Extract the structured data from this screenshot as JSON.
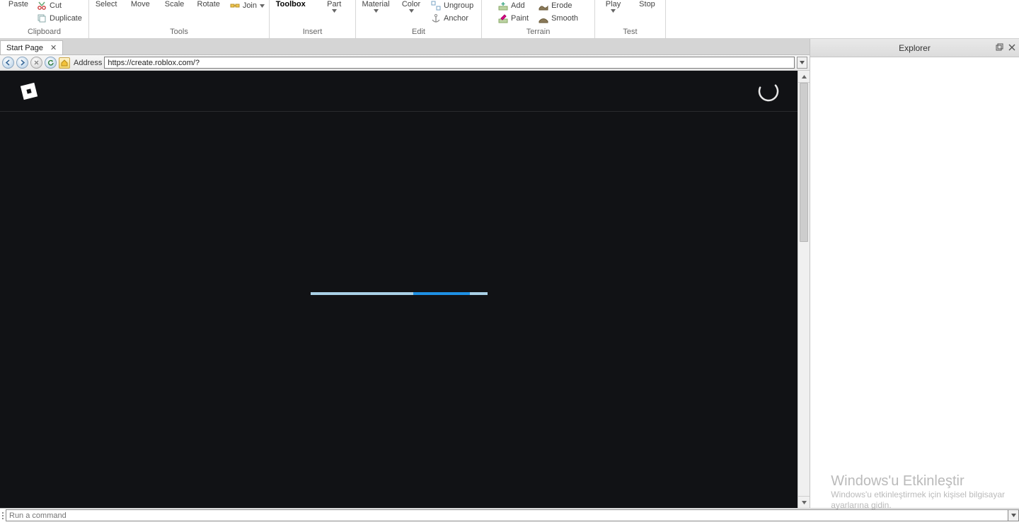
{
  "ribbon": {
    "clipboard": {
      "paste": "Paste",
      "cut": "Cut",
      "duplicate": "Duplicate",
      "group": "Clipboard"
    },
    "tools": {
      "select": "Select",
      "move": "Move",
      "scale": "Scale",
      "rotate": "Rotate",
      "join": "Join",
      "group": "Tools"
    },
    "insert": {
      "toolbox": "Toolbox",
      "part": "Part",
      "group": "Insert"
    },
    "edit": {
      "material": "Material",
      "color": "Color",
      "ungroup": "Ungroup",
      "anchor": "Anchor",
      "group": "Edit"
    },
    "terrain": {
      "add": "Add",
      "paint": "Paint",
      "erode": "Erode",
      "smooth": "Smooth",
      "group": "Terrain"
    },
    "test": {
      "play": "Play",
      "stop": "Stop",
      "group": "Test"
    }
  },
  "tab": {
    "label": "Start Page"
  },
  "nav": {
    "address_label": "Address",
    "url": "https://create.roblox.com/?"
  },
  "explorer": {
    "title": "Explorer"
  },
  "command": {
    "placeholder": "Run a command"
  },
  "watermark": {
    "title": "Windows'u Etkinleştir",
    "line1": "Windows'u etkinleştirmek için kişisel bilgisayar",
    "line2": "ayarlarına gidin."
  }
}
